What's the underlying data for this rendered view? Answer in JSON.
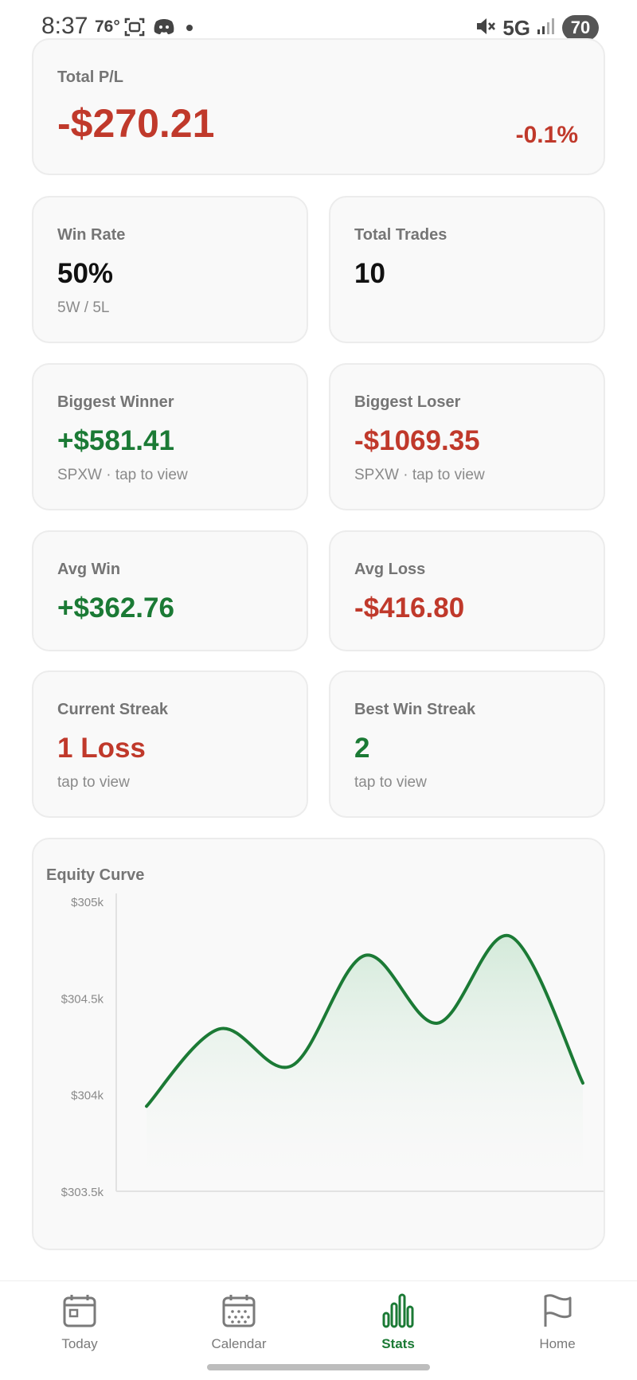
{
  "status_bar": {
    "time": "8:37",
    "temp": "76°",
    "network": "5G",
    "battery": "70"
  },
  "total_pl": {
    "label": "Total P/L",
    "value": "-$270.21",
    "percent": "-0.1%"
  },
  "stats": {
    "win_rate": {
      "label": "Win Rate",
      "value": "50%",
      "sub": "5W / 5L"
    },
    "total_trades": {
      "label": "Total Trades",
      "value": "10"
    },
    "biggest_winner": {
      "label": "Biggest Winner",
      "value": "+$581.41",
      "sub": "SPXW · tap to view"
    },
    "biggest_loser": {
      "label": "Biggest Loser",
      "value": "-$1069.35",
      "sub": "SPXW · tap to view"
    },
    "avg_win": {
      "label": "Avg Win",
      "value": "+$362.76"
    },
    "avg_loss": {
      "label": "Avg Loss",
      "value": "-$416.80"
    },
    "current_streak": {
      "label": "Current Streak",
      "value": "1 Loss",
      "sub": "tap to view"
    },
    "best_win_streak": {
      "label": "Best Win Streak",
      "value": "2",
      "sub": "tap to view"
    }
  },
  "equity_curve": {
    "title": "Equity Curve",
    "y_ticks": [
      "$305k",
      "$304.5k",
      "$304k",
      "$303.5k"
    ]
  },
  "chart_data": {
    "type": "area",
    "title": "Equity Curve",
    "xlabel": "",
    "ylabel": "",
    "ylim": [
      303500,
      305000
    ],
    "y_ticks": [
      305000,
      304500,
      304000,
      303500
    ],
    "y_tick_labels": [
      "$305k",
      "$304.5k",
      "$304k",
      "$303.5k"
    ],
    "grid": false,
    "series": [
      {
        "values": [
          303940,
          304340,
          304150,
          304720,
          304370,
          304820,
          304060
        ]
      }
    ],
    "colors": {
      "line": "#1b7a35",
      "fill": "#d8eedd"
    }
  },
  "nav": {
    "items": [
      {
        "label": "Today"
      },
      {
        "label": "Calendar"
      },
      {
        "label": "Stats"
      },
      {
        "label": "Home"
      }
    ],
    "active": "Stats"
  },
  "colors": {
    "positive": "#1b7a35",
    "negative": "#c0392b",
    "card_bg": "#f9f9f9"
  }
}
